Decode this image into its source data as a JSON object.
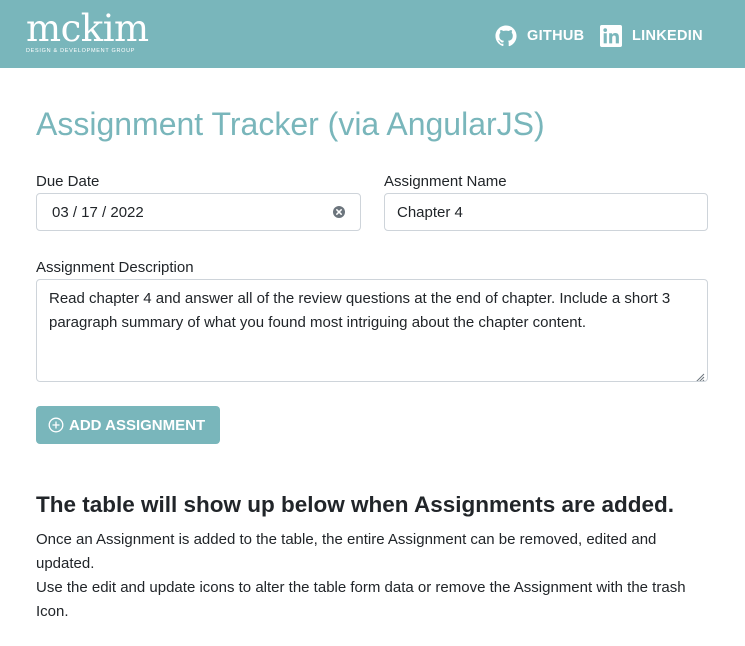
{
  "navbar": {
    "brand_name": "mckim",
    "brand_tagline": "DESIGN & DEVELOPMENT GROUP",
    "links": [
      {
        "label": "GITHUB",
        "icon": "github-icon"
      },
      {
        "label": "LINKEDIN",
        "icon": "linkedin-icon"
      }
    ],
    "color": "#79b6bb"
  },
  "page": {
    "title": "Assignment Tracker (via AngularJS)"
  },
  "form": {
    "due_date": {
      "label": "Due Date",
      "value": "03 / 17 / 2022"
    },
    "assignment_name": {
      "label": "Assignment Name",
      "value": "Chapter 4"
    },
    "assignment_description": {
      "label": "Assignment Description",
      "value": "Read chapter 4 and answer all of the review questions at the end of chapter. Include a short 3 paragraph summary of what you found most intriguing about the chapter content."
    },
    "add_button": {
      "label": "ADD ASSIGNMENT",
      "icon": "plus-circle-icon"
    }
  },
  "info": {
    "heading": "The table will show up below when Assignments are added.",
    "paragraph_1": "Once an Assignment is added to the table, the entire Assignment can be removed, edited and updated.",
    "paragraph_2": "Use the edit and update icons to alter the table form data or remove the Assignment with the trash Icon."
  }
}
